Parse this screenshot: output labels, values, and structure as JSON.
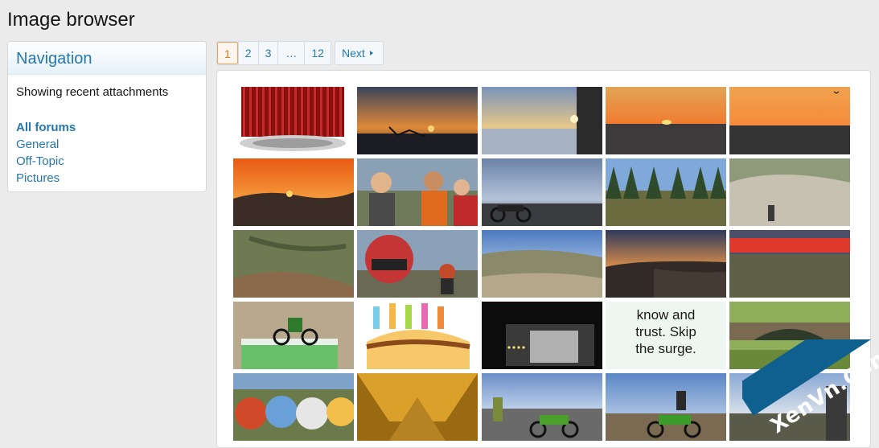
{
  "page": {
    "title": "Image browser"
  },
  "sidebar": {
    "header": "Navigation",
    "description": "Showing recent attachments",
    "links": [
      {
        "label": "All forums",
        "active": true
      },
      {
        "label": "General",
        "active": false
      },
      {
        "label": "Off-Topic",
        "active": false
      },
      {
        "label": "Pictures",
        "active": false
      }
    ]
  },
  "pagination": {
    "pages": [
      "1",
      "2",
      "3",
      "…",
      "12"
    ],
    "current": "1",
    "next_label": "Next"
  },
  "gallery": {
    "thumbnails": [
      {
        "subject": "red-air-filter"
      },
      {
        "subject": "sunset-over-coast"
      },
      {
        "subject": "sunset-over-beach"
      },
      {
        "subject": "orange-sunset-horizon"
      },
      {
        "subject": "sunset-with-bird"
      },
      {
        "subject": "orange-sunset-hills"
      },
      {
        "subject": "riders-group-selfie"
      },
      {
        "subject": "motorcycle-at-dusk"
      },
      {
        "subject": "pine-forest-trail"
      },
      {
        "subject": "dirt-road-shadow"
      },
      {
        "subject": "dirt-hillside-trail"
      },
      {
        "subject": "helmet-selfie-rider"
      },
      {
        "subject": "hills-overlook"
      },
      {
        "subject": "coast-sunset-view"
      },
      {
        "subject": "red-sky-desert"
      },
      {
        "subject": "dirt-bike-birthday-cake"
      },
      {
        "subject": "birthday-cake-illustration"
      },
      {
        "subject": "garage-night-lights"
      },
      {
        "subject": "text-card"
      },
      {
        "subject": "stone-bridge-park"
      },
      {
        "subject": "painted-discs-row"
      },
      {
        "subject": "yellow-tunnel-road"
      },
      {
        "subject": "rider-with-green-bike"
      },
      {
        "subject": "rider-waving-on-bike"
      },
      {
        "subject": "riders-on-road"
      }
    ],
    "text_card": {
      "lines": [
        "know and",
        "trust. Skip",
        "the surge."
      ]
    }
  },
  "watermark": {
    "text": "XenVn.Com"
  }
}
